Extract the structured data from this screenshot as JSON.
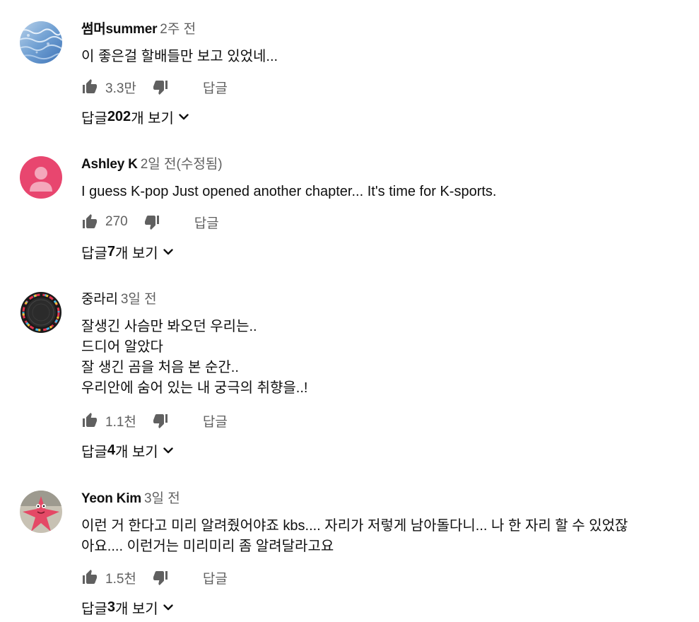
{
  "comments": [
    {
      "author": "썸머summer",
      "time": "2주 전",
      "lines": [
        "이 좋은걸 할배들만 보고 있었네..."
      ],
      "likes": "3.3만",
      "reply_label": "답글",
      "replies": {
        "prefix": "답글 ",
        "count": "202",
        "suffix": "개 보기"
      },
      "avatar": "water-photo"
    },
    {
      "author": "Ashley K",
      "time": "2일 전(수정됨)",
      "lines": [
        "I guess K-pop Just opened another chapter... It's time for K-sports."
      ],
      "likes": "270",
      "reply_label": "답글",
      "replies": {
        "prefix": "답글 ",
        "count": "7",
        "suffix": "개 보기"
      },
      "avatar": "default-person-pink"
    },
    {
      "author": "중라리",
      "time": "3일 전",
      "lines": [
        "잘생긴 사슴만 봐오던 우리는..",
        "드디어 알았다",
        "잘 생긴 곰을 처음 본 순간..",
        "우리안에 숨어 있는 내 궁극의 취향을..!"
      ],
      "likes": "1.1천",
      "reply_label": "답글",
      "replies": {
        "prefix": "답글 ",
        "count": "4",
        "suffix": "개 보기"
      },
      "avatar": "colorful-ring"
    },
    {
      "author": "Yeon Kim",
      "time": "3일 전",
      "lines": [
        "이런 거 한다고 미리 알려줬어야죠 kbs.... 자리가 저렇게 남아돌다니... 나 한 자리 할 수 있었잖",
        "아요.... 이런거는 미리미리 좀 알려달라고요"
      ],
      "likes": "1.5천",
      "reply_label": "답글",
      "replies": {
        "prefix": "답글 ",
        "count": "3",
        "suffix": "개 보기"
      },
      "avatar": "pink-starfish"
    }
  ],
  "icons": {
    "like": "thumbs-up-icon",
    "dislike": "thumbs-down-icon",
    "expand": "chevron-down-icon"
  },
  "colors": {
    "text": "#0f0f0f",
    "secondary": "#606060",
    "avatar_pink": "#e8466f"
  }
}
